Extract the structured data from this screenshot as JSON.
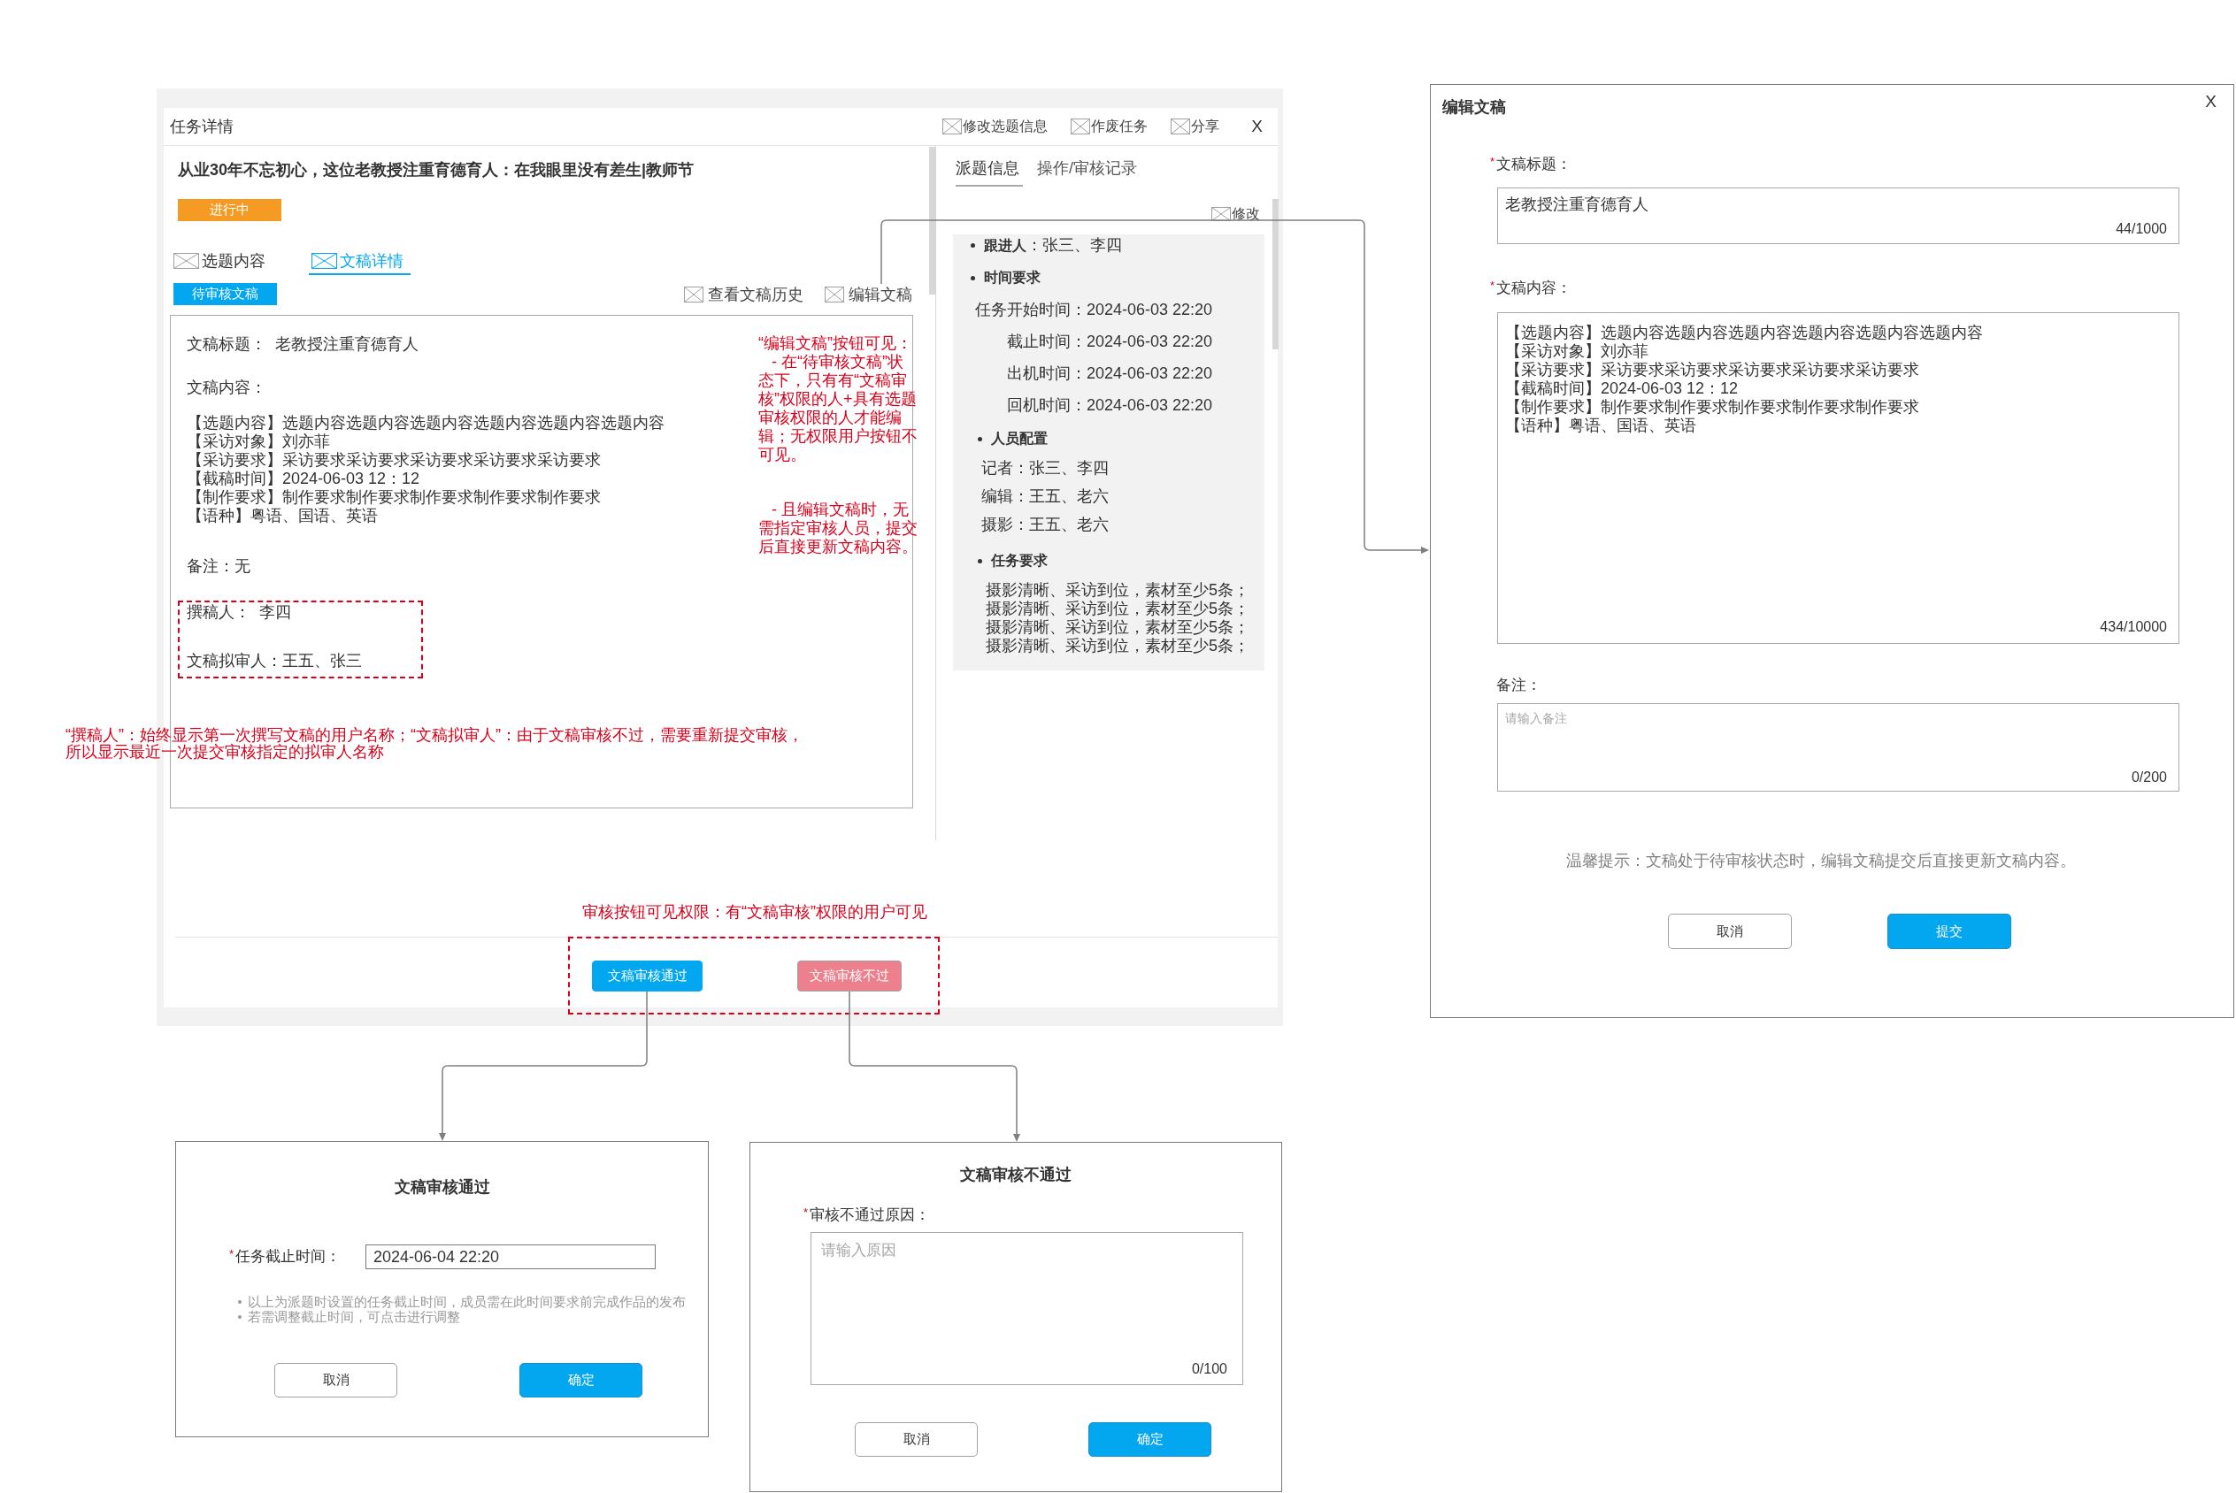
{
  "task_detail": {
    "title": "任务详情",
    "header_actions": [
      {
        "label": "修改选题信息"
      },
      {
        "label": "作废任务"
      },
      {
        "label": "分享"
      }
    ],
    "close": "X",
    "article_title": "从业30年不忘初心，这位老教授注重育德育人：在我眼里没有差生|教师节",
    "status": "进行中",
    "tabs": [
      {
        "label": "选题内容",
        "selected": false
      },
      {
        "label": "文稿详情",
        "selected": true
      }
    ],
    "draft_status": "待审核文稿",
    "draft_actions": [
      {
        "label": "查看文稿历史"
      },
      {
        "label": "编辑文稿"
      }
    ],
    "draft": {
      "title": "文稿标题：  老教授注重育德育人",
      "content_label": "文稿内容：",
      "content_lines": [
        "【选题内容】选题内容选题内容选题内容选题内容选题内容选题内容",
        "【采访对象】刘亦菲",
        "【采访要求】采访要求采访要求采访要求采访要求采访要求",
        "【截稿时间】2024-06-03 12：12",
        "【制作要求】制作要求制作要求制作要求制作要求制作要求",
        "【语种】粤语、国语、英语"
      ],
      "note": "备注：无",
      "people": [
        "撰稿人：  李四",
        "文稿拟审人：王五、张三"
      ],
      "edit_annotation": [
        "“编辑文稿”按钮可见：",
        "- 在“待审核文稿”状态下，只有有“文稿审核”权限的人+具有选题审核权限的人才能编辑；无权限用户按钮不可见。",
        "- 且编辑文稿时，无需指定审核人员，提交后直接更新文稿内容。"
      ],
      "people_annotation": "“撰稿人”：始终显示第一次撰写文稿的用户名称；“文稿拟审人”：由于文稿审核不过，需要重新提交审核，所以显示最近一次提交审核指定的拟审人名称"
    },
    "side_tabs": [
      {
        "label": "派题信息",
        "selected": true
      },
      {
        "label": "操作/审核记录",
        "selected": false
      }
    ],
    "side_edit": "修改",
    "assignment": [
      {
        "kind": "inline",
        "text": "**跟进人**：张三、李四"
      },
      {
        "kind": "aligned",
        "heading": "时间要求",
        "rows": [
          {
            "label": "任务开始时间：",
            "value": "2024-06-03 22:20"
          },
          {
            "label": "截止时间：",
            "value": "2024-06-03 22:20"
          },
          {
            "label": "出机时间：",
            "value": "2024-06-03 22:20"
          },
          {
            "label": "回机时间：",
            "value": "2024-06-03 22:20"
          }
        ]
      },
      {
        "kind": "plain",
        "heading": "人员配置",
        "rows": [
          {
            "label": "记者：",
            "value": "张三、李四"
          },
          {
            "label": "编辑：",
            "value": "王五、老六"
          },
          {
            "label": "摄影：",
            "value": "王五、老六"
          }
        ]
      },
      {
        "kind": "lines",
        "heading": "任务要求",
        "lines": [
          "摄影清晰、采访到位，素材至少5条；",
          "摄影清晰、采访到位，素材至少5条；",
          "摄影清晰、采访到位，素材至少5条；",
          "摄影清晰、采访到位，素材至少5条；"
        ]
      }
    ],
    "review_annotation": "审核按钮可见权限：有“文稿审核”权限的用户可见",
    "review_buttons": [
      {
        "label": "文稿审核通过",
        "kind": "approve"
      },
      {
        "label": "文稿审核不过",
        "kind": "reject"
      }
    ]
  },
  "edit_dialog": {
    "title": "编辑文稿",
    "close": "X",
    "fields": [
      {
        "kind": "title",
        "required_mark": "*",
        "label": "文稿标题：",
        "value_lines": [
          "老教授注重育德育人"
        ],
        "counter": "44/1000"
      },
      {
        "kind": "content",
        "required_mark": "*",
        "label": "文稿内容：",
        "value_lines": [
          "【选题内容】选题内容选题内容选题内容选题内容选题内容选题内容",
          "【采访对象】刘亦菲",
          "【采访要求】采访要求采访要求采访要求采访要求采访要求",
          "【截稿时间】2024-06-03 12：12",
          "【制作要求】制作要求制作要求制作要求制作要求制作要求",
          "【语种】粤语、国语、英语"
        ],
        "counter": "434/10000"
      },
      {
        "kind": "remark",
        "label": "备注：",
        "placeholder": "请输入备注",
        "counter": "0/200"
      }
    ],
    "hint": "温馨提示：文稿处于待审核状态时，编辑文稿提交后直接更新文稿内容。",
    "buttons": [
      {
        "label": "取消",
        "kind": "secondary"
      },
      {
        "label": "提交",
        "kind": "primary"
      }
    ]
  },
  "approve_dialog": {
    "title": "文稿审核通过",
    "field": {
      "required_mark": "*",
      "label": "任务截止时间：",
      "value": "2024-06-04 22:20"
    },
    "tips": [
      "以上为派题时设置的任务截止时间，成员需在此时间要求前完成作品的发布",
      "若需调整截止时间，可点击进行调整"
    ],
    "buttons": [
      {
        "label": "取消",
        "kind": "secondary"
      },
      {
        "label": "确定",
        "kind": "primary"
      }
    ]
  },
  "reject_dialog": {
    "title": "文稿审核不通过",
    "field": {
      "required_mark": "*",
      "label": "审核不通过原因：",
      "placeholder": "请输入原因",
      "counter": "0/100"
    },
    "buttons": [
      {
        "label": "取消",
        "kind": "secondary"
      },
      {
        "label": "确定",
        "kind": "primary"
      }
    ]
  }
}
